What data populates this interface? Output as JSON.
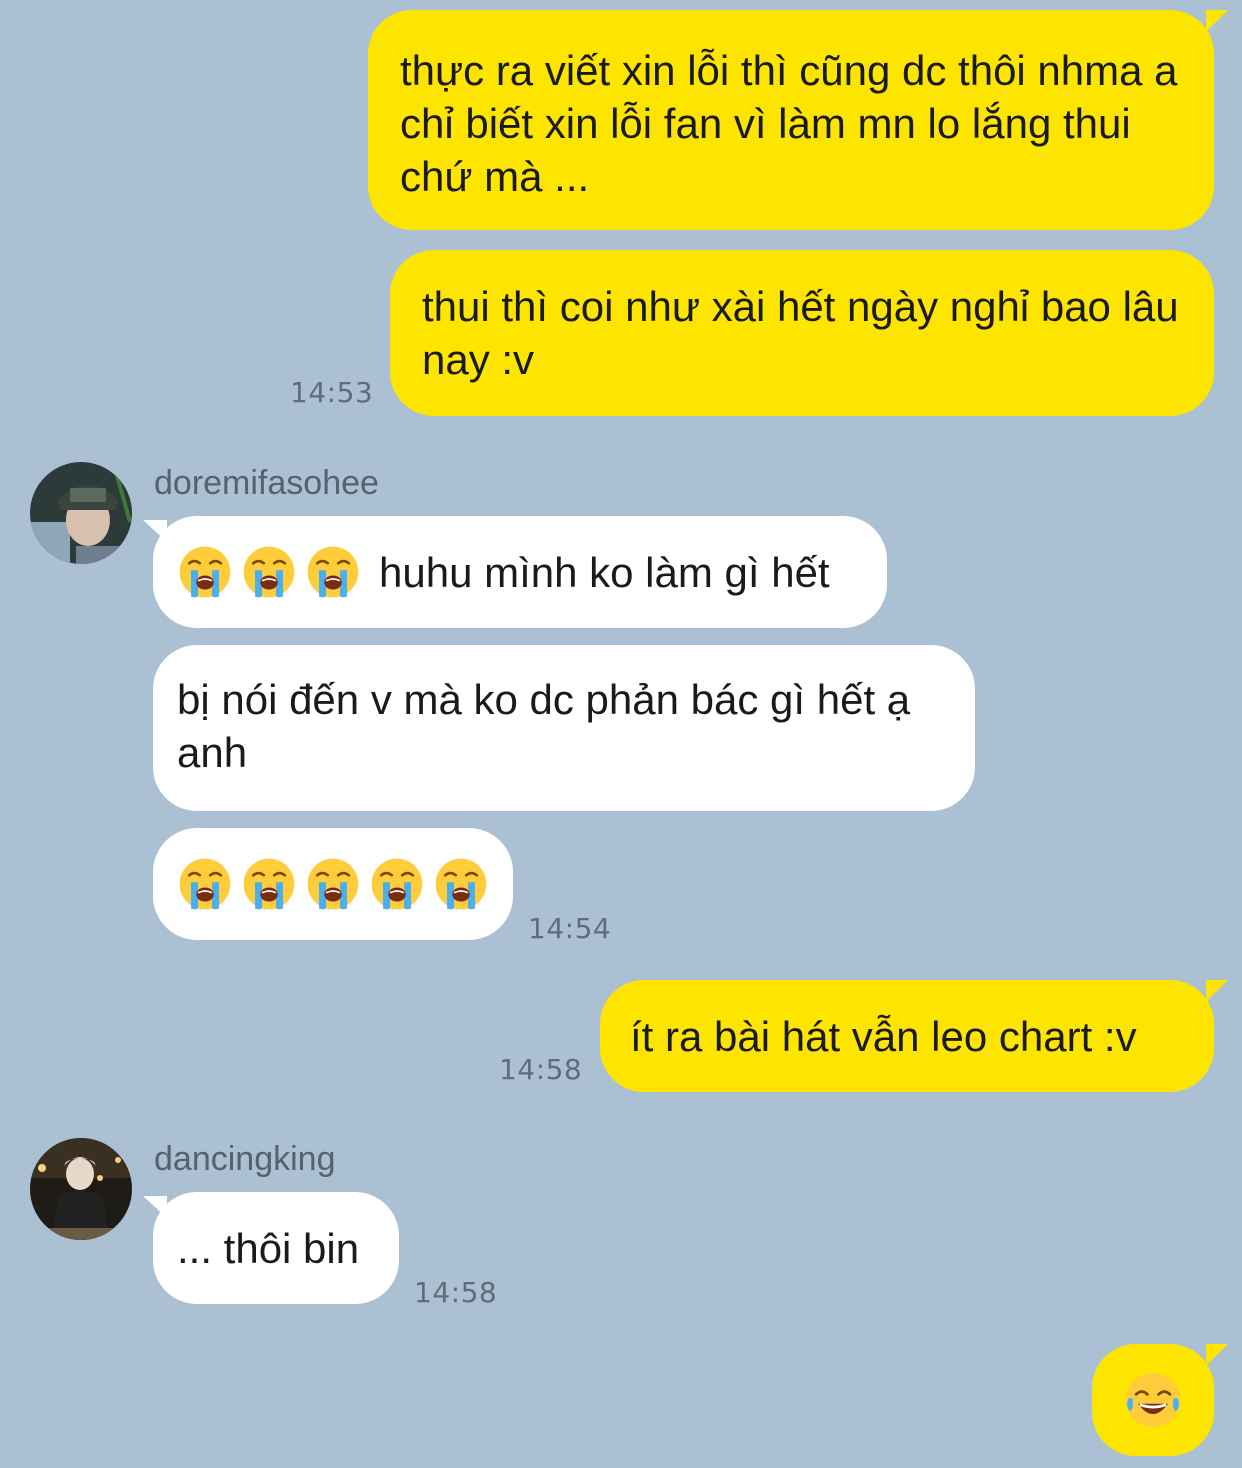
{
  "colors": {
    "background": "#abc1d3",
    "outgoing_bubble": "#fee500",
    "incoming_bubble": "#ffffff",
    "timestamp": "#5f6d7a"
  },
  "messages": [
    {
      "id": "m1",
      "direction": "out",
      "text": "thực ra viết xin lỗi thì cũng dc thôi nhma a chỉ biết xin lỗi fan vì làm mn lo lắng thui chứ mà ..."
    },
    {
      "id": "m2",
      "direction": "out",
      "text": "thui thì coi như xài hết ngày nghỉ bao lâu nay :v",
      "time": "14:53"
    },
    {
      "id": "m3",
      "direction": "in",
      "sender": "doremifasohee",
      "prefix_emoji": [
        "loudly-crying-face",
        "loudly-crying-face",
        "loudly-crying-face"
      ],
      "text": "huhu mình ko làm gì hết"
    },
    {
      "id": "m4",
      "direction": "in",
      "text": "bị nói đến v mà ko dc phản bác gì hết ạ anh"
    },
    {
      "id": "m5",
      "direction": "in",
      "emoji": [
        "loudly-crying-face",
        "loudly-crying-face",
        "loudly-crying-face",
        "loudly-crying-face",
        "loudly-crying-face"
      ],
      "time": "14:54"
    },
    {
      "id": "m6",
      "direction": "out",
      "text": "ít ra bài hát vẫn leo chart :v",
      "time": "14:58"
    },
    {
      "id": "m7",
      "direction": "in",
      "sender": "dancingking",
      "text": "... thôi bin",
      "time": "14:58"
    },
    {
      "id": "m8",
      "direction": "out",
      "emoji": [
        "face-with-tears-of-joy"
      ]
    }
  ]
}
